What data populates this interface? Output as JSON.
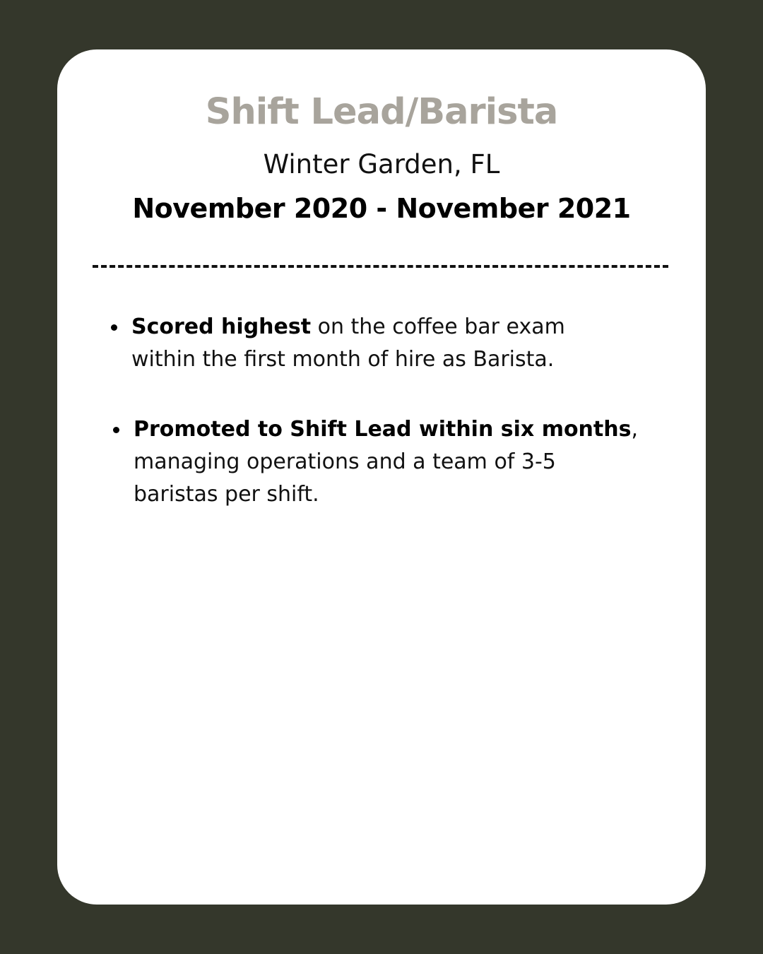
{
  "job": {
    "title": "Shift Lead/Barista",
    "location": "Winter Garden, FL",
    "dates": "November 2020 - November 2021"
  },
  "divider": "---------------------------------------------------",
  "bullets": [
    {
      "bold": "Scored highest",
      "text": " on the coffee bar exam within the first month of hire as Barista."
    },
    {
      "bold": "Promoted to Shift Lead within six months",
      "text": ", managing operations and a team of 3-5 baristas per shift."
    }
  ],
  "colors": {
    "background": "#34372b",
    "card": "#ffffff",
    "title": "#a8a49c",
    "text": "#111111"
  }
}
